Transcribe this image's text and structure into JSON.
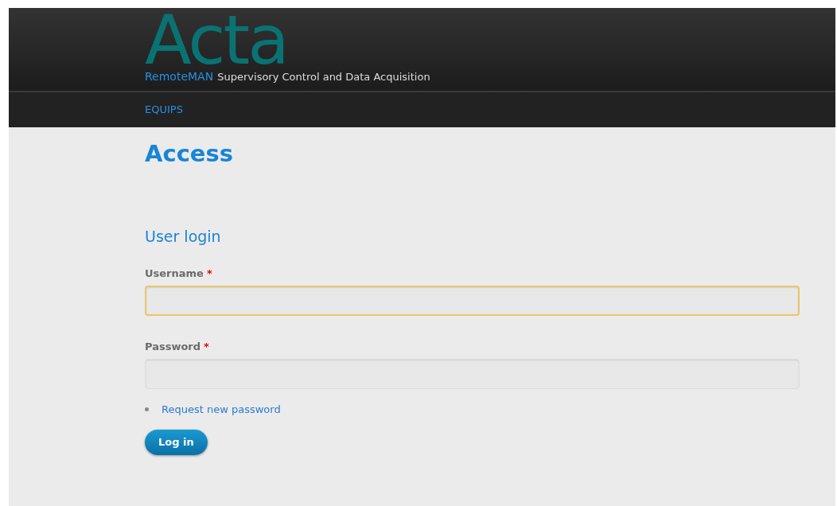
{
  "header": {
    "logo": "Acta",
    "brand": "RemoteMAN",
    "tagline": "Supervisory Control and Data Acquisition"
  },
  "nav": [
    {
      "label": "EQUIPS",
      "selected": false
    }
  ],
  "page_title": "Access",
  "login": {
    "title": "User login",
    "fields": [
      {
        "label": "Username",
        "required_mark": "*",
        "focused": true
      },
      {
        "label": "Password",
        "required_mark": "*",
        "focused": false
      }
    ],
    "links": [
      "Request new password"
    ],
    "submit": "Log in"
  }
}
